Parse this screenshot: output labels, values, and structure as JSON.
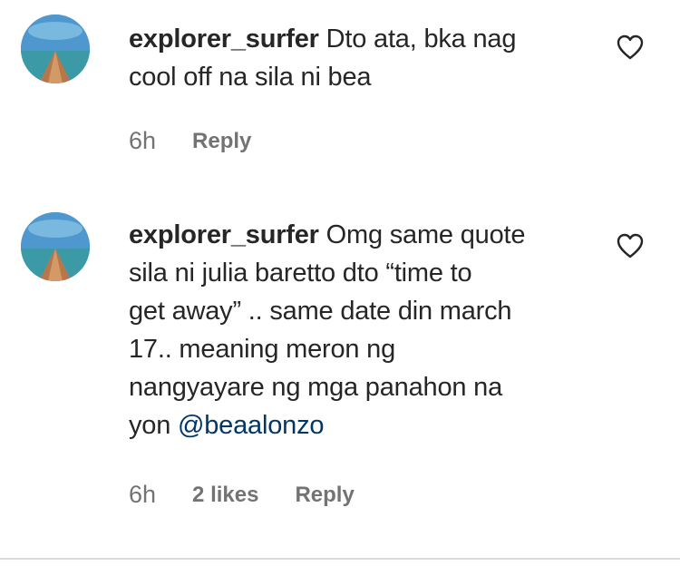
{
  "comments": [
    {
      "username": "explorer_surfer",
      "text_lines": [
        "Dto ata, bka nag",
        "cool off na sila ni bea"
      ],
      "time": "6h",
      "reply_label": "Reply"
    },
    {
      "username": "explorer_surfer",
      "text_lines": [
        "Omg same quote",
        "sila ni julia baretto dto “time to",
        "get away” .. same date din march",
        "17.. meaning meron ng",
        "nangyayare ng mga panahon na",
        "yon "
      ],
      "mention": "@beaalonzo",
      "time": "6h",
      "likes": "2 likes",
      "reply_label": "Reply"
    }
  ],
  "icons": {
    "like": "heart-outline-icon",
    "avatar": "beach-photo-avatar"
  },
  "colors": {
    "text": "#262626",
    "meta": "#737373",
    "mention": "#00376b",
    "divider": "#dbdbdb"
  }
}
